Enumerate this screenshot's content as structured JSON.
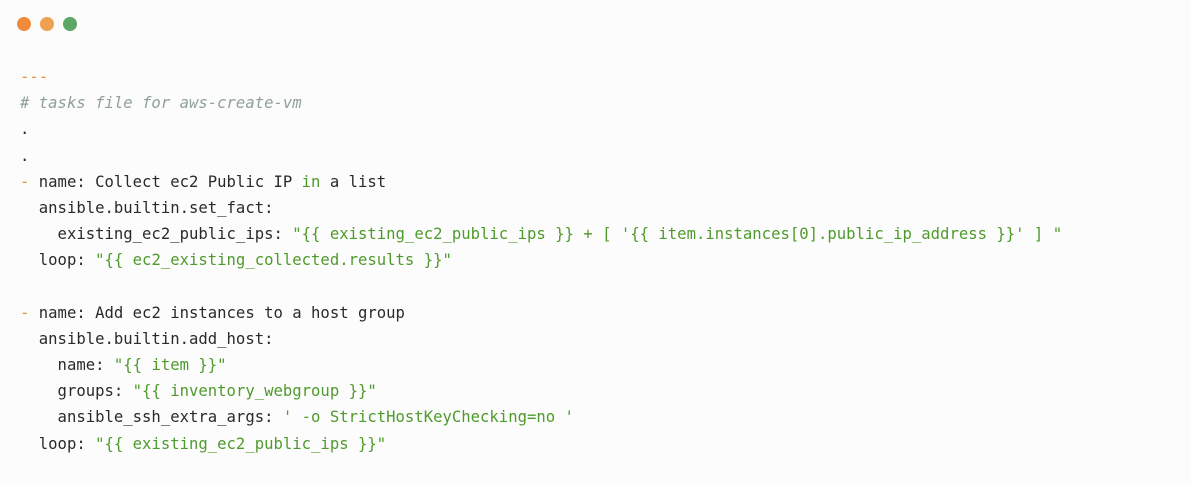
{
  "window": {
    "dots": [
      {
        "name": "close",
        "color": "#f08a3c"
      },
      {
        "name": "minimize",
        "color": "#f0a050"
      },
      {
        "name": "maximize",
        "color": "#5aa864"
      }
    ]
  },
  "code": {
    "lines": [
      [
        {
          "t": "dash",
          "v": "---"
        }
      ],
      [
        {
          "t": "comment",
          "v": "# tasks file for aws-create-vm"
        }
      ],
      [
        {
          "t": "text",
          "v": "."
        }
      ],
      [
        {
          "t": "text",
          "v": "."
        }
      ],
      [
        {
          "t": "dash",
          "v": "- "
        },
        {
          "t": "key",
          "v": "name: Collect ec2 Public IP "
        },
        {
          "t": "kw",
          "v": "in"
        },
        {
          "t": "key",
          "v": " a list"
        }
      ],
      [
        {
          "t": "key",
          "v": "  ansible.builtin.set_fact:"
        }
      ],
      [
        {
          "t": "key",
          "v": "    existing_ec2_public_ips: "
        },
        {
          "t": "str",
          "v": "\"{{ existing_ec2_public_ips }} + [ '{{ item.instances[0].public_ip_address }}' ] \""
        }
      ],
      [
        {
          "t": "key",
          "v": "  loop: "
        },
        {
          "t": "str",
          "v": "\"{{ ec2_existing_collected.results }}\""
        }
      ],
      [],
      [
        {
          "t": "dash",
          "v": "- "
        },
        {
          "t": "key",
          "v": "name: Add ec2 instances to a host group"
        }
      ],
      [
        {
          "t": "key",
          "v": "  ansible.builtin.add_host:"
        }
      ],
      [
        {
          "t": "key",
          "v": "    name: "
        },
        {
          "t": "str",
          "v": "\"{{ item }}\""
        }
      ],
      [
        {
          "t": "key",
          "v": "    groups: "
        },
        {
          "t": "str",
          "v": "\"{{ inventory_webgroup }}\""
        }
      ],
      [
        {
          "t": "key",
          "v": "    ansible_ssh_extra_args: "
        },
        {
          "t": "str",
          "v": "' -o StrictHostKeyChecking=no '"
        }
      ],
      [
        {
          "t": "key",
          "v": "  loop: "
        },
        {
          "t": "str",
          "v": "\"{{ existing_ec2_public_ips }}\""
        }
      ]
    ]
  }
}
